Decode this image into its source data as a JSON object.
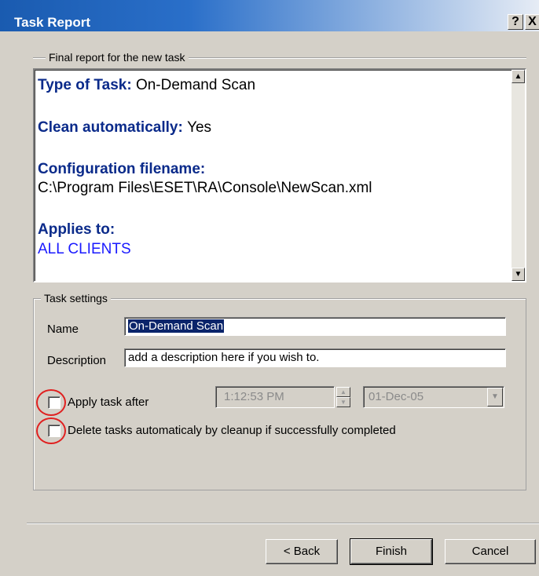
{
  "window": {
    "title": "Task Report",
    "help_button": "?",
    "close_button": "X"
  },
  "report_group": {
    "label": "Final report for the new task",
    "type_of_task_label": "Type of Task:",
    "type_of_task_value": "On-Demand Scan",
    "clean_label": "Clean automatically:",
    "clean_value": "Yes",
    "config_label": "Configuration filename:",
    "config_value": "C:\\Program Files\\ESET\\RA\\Console\\NewScan.xml",
    "applies_label": "Applies to:",
    "applies_value": "ALL CLIENTS"
  },
  "settings_group": {
    "label": "Task settings",
    "name_label": "Name",
    "name_value": "On-Demand Scan",
    "description_label": "Description",
    "description_value": "add a description here if you wish to.",
    "apply_after_label": "Apply task after",
    "apply_after_checked": false,
    "time_value": "1:12:53 PM",
    "date_value": "01-Dec-05",
    "delete_label": "Delete tasks automaticaly by cleanup if successfully completed",
    "delete_checked": false
  },
  "buttons": {
    "back": "< Back",
    "finish": "Finish",
    "cancel": "Cancel"
  },
  "icons": {
    "scroll_up": "▲",
    "scroll_down": "▼",
    "spin_up": "▲",
    "spin_down": "▼",
    "dropdown": "▼"
  },
  "colors": {
    "annotation_circle": "#e02020",
    "report_heading": "#0a2a8a",
    "link": "#1a1aff"
  }
}
